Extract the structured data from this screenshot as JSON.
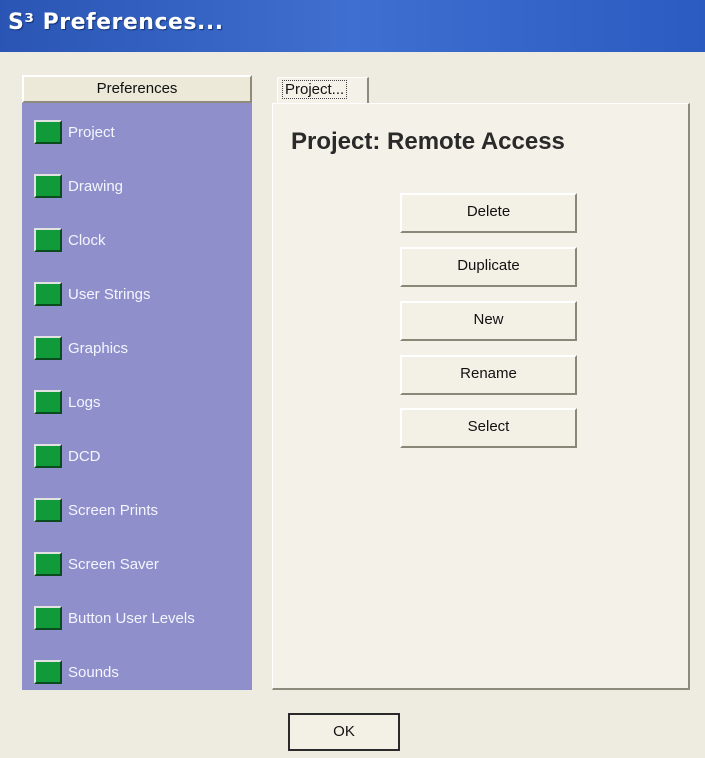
{
  "window": {
    "title": "S³ Preferences..."
  },
  "sidebar": {
    "header": "Preferences",
    "items": [
      {
        "label": "Project",
        "icon": "green-square-icon"
      },
      {
        "label": "Drawing",
        "icon": "green-square-icon"
      },
      {
        "label": "Clock",
        "icon": "green-square-icon"
      },
      {
        "label": "User Strings",
        "icon": "green-square-icon"
      },
      {
        "label": "Graphics",
        "icon": "green-square-icon"
      },
      {
        "label": "Logs",
        "icon": "green-square-icon"
      },
      {
        "label": "DCD",
        "icon": "green-square-icon"
      },
      {
        "label": "Screen Prints",
        "icon": "green-square-icon"
      },
      {
        "label": "Screen Saver",
        "icon": "green-square-icon"
      },
      {
        "label": "Button User Levels",
        "icon": "green-square-icon"
      },
      {
        "label": "Sounds",
        "icon": "green-square-icon"
      }
    ]
  },
  "main": {
    "tab_label": "Project...",
    "title": "Project: Remote Access",
    "buttons": {
      "delete": "Delete",
      "duplicate": "Duplicate",
      "new": "New",
      "rename": "Rename",
      "select": "Select"
    }
  },
  "footer": {
    "ok_label": "OK"
  },
  "colors": {
    "titlebar": "#2f5fc4",
    "sidebar_bg": "#8f8fcb",
    "icon_green": "#109a3a",
    "panel_bg": "#f4f2e8"
  }
}
